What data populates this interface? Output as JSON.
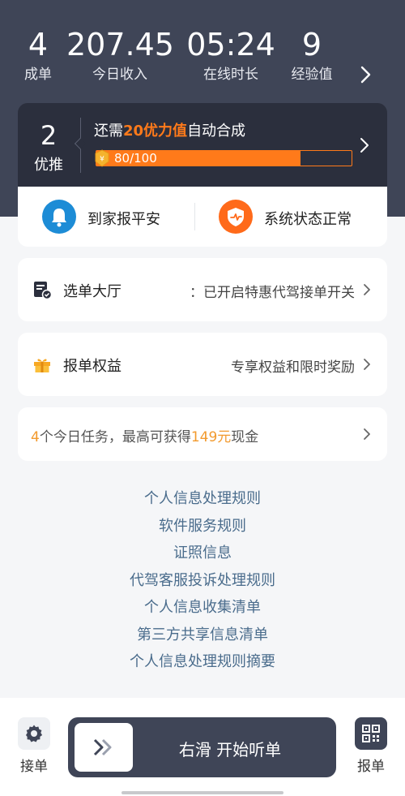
{
  "stats": [
    {
      "value": "4",
      "label": "成单"
    },
    {
      "value": "207.45",
      "label": "今日收入"
    },
    {
      "value": "05:24",
      "label": "在线时长"
    },
    {
      "value": "9",
      "label": "经验值"
    }
  ],
  "promo": {
    "count": "2",
    "count_label": "优推",
    "title_prefix": "还需",
    "title_highlight": "20优力值",
    "title_suffix": "自动合成",
    "progress_text": "80/100",
    "progress_value": 80,
    "progress_max": 100
  },
  "safety": {
    "report_label": "到家报平安",
    "status_label": "系统状态正常"
  },
  "cards": {
    "hall": {
      "title": "选单大厅",
      "detail": "：已开启特惠代驾接单开关"
    },
    "rights": {
      "title": "报单权益",
      "detail": "专享权益和限时奖励"
    },
    "tasks": {
      "count": "4",
      "mid": "个今日任务，最高可获得",
      "amount": "149元",
      "suffix": "现金"
    }
  },
  "links": [
    "个人信息处理规则",
    "软件服务规则",
    "证照信息",
    "代驾客服投诉处理规则",
    "个人信息收集清单",
    "第三方共享信息清单",
    "个人信息处理规则摘要"
  ],
  "bottom": {
    "left_label": "接单",
    "slider_text": "右滑  开始听单",
    "right_label": "报单"
  },
  "colors": {
    "header": "#3f4557",
    "accent": "#ff7a1a",
    "link": "#4a6c8c"
  }
}
